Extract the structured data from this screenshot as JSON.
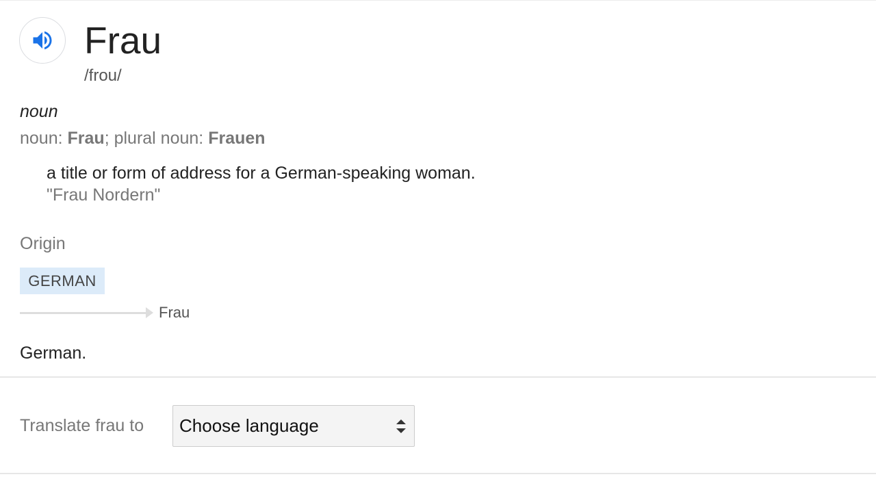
{
  "entry": {
    "headword": "Frau",
    "phonetic": "/frou/",
    "speaker_icon": "volume-up-icon",
    "accent_color": "#1a73e8"
  },
  "sense": {
    "part_of_speech": "noun",
    "inflection_prefix": "noun: ",
    "inflection_singular": "Frau",
    "inflection_separator": "; plural noun: ",
    "inflection_plural": "Frauen",
    "definition": "a title or form of address for a German-speaking woman.",
    "example": "\"Frau Nordern\""
  },
  "origin": {
    "label": "Origin",
    "language_tag": "GERMAN",
    "language_tag_bg": "#dcebf9",
    "derived_word": "Frau",
    "note": "German."
  },
  "translate": {
    "label": "Translate frau to",
    "selected_language": "Choose language",
    "dropdown_icon": "select-arrows-icon"
  }
}
